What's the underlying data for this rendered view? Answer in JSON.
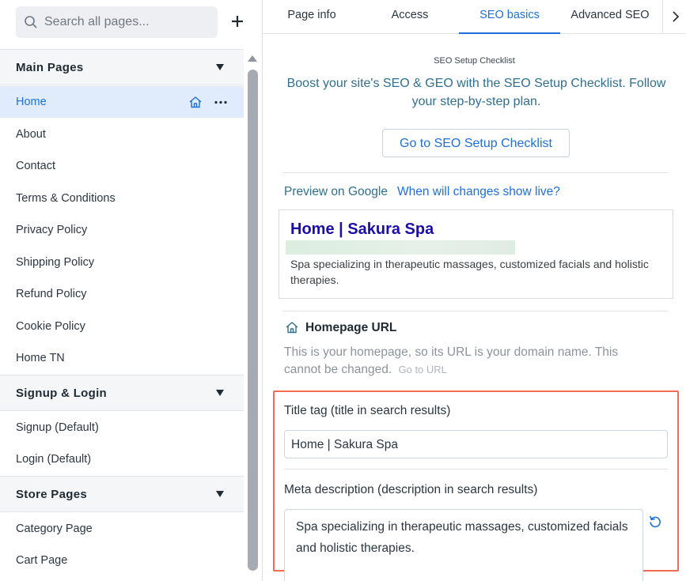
{
  "search": {
    "placeholder": "Search all pages..."
  },
  "sections": {
    "main": {
      "title": "Main Pages",
      "items": [
        "Home",
        "About",
        "Contact",
        "Terms & Conditions",
        "Privacy Policy",
        "Shipping Policy",
        "Refund Policy",
        "Cookie Policy",
        "Home TN"
      ]
    },
    "signup": {
      "title": "Signup & Login",
      "items": [
        "Signup (Default)",
        "Login (Default)"
      ]
    },
    "store": {
      "title": "Store Pages",
      "items": [
        "Category Page",
        "Cart Page"
      ]
    }
  },
  "tabs": [
    "Page info",
    "Access",
    "SEO basics",
    "Advanced SEO"
  ],
  "active_tab": "SEO basics",
  "checklist": {
    "small_title": "SEO Setup Checklist",
    "text": "Boost your site's SEO & GEO with the SEO Setup Checklist. Follow your step-by-step plan.",
    "button": "Go to SEO Setup Checklist"
  },
  "preview": {
    "label": "Preview on Google",
    "link": "When will changes show live?",
    "google_title": "Home | Sakura Spa",
    "google_desc": "Spa specializing in therapeutic massages, customized facials and holistic therapies."
  },
  "homepage_url": {
    "title": "Homepage URL",
    "desc": "This is your homepage, so its URL is your domain name. This cannot be changed.",
    "link": "Go to URL"
  },
  "title_tag": {
    "label": "Title tag (title in search results)",
    "value": "Home | Sakura Spa"
  },
  "meta_description": {
    "label": "Meta description (description in search results)",
    "value": "Spa specializing in therapeutic massages, customized facials and holistic therapies."
  },
  "colors": {
    "accent": "#1e6fd9",
    "highlight": "#f06b52",
    "google_title": "#1a0dab"
  }
}
